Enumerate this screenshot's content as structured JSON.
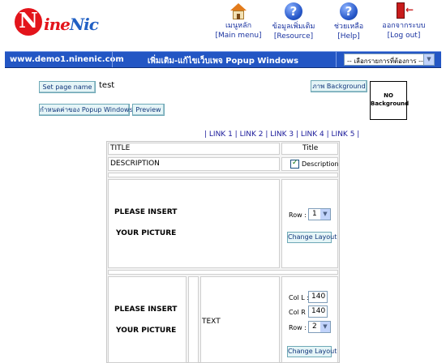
{
  "brand": {
    "logo_n": "N",
    "logo_rest_red": "ine",
    "logo_rest_blue": "Nic",
    "colors": {
      "red": "#e3141b",
      "blue": "#2160c4",
      "bar": "#2356c4"
    }
  },
  "nav": [
    {
      "icon": "home-icon",
      "thai": "เมนูหลัก",
      "eng": "[Main menu]"
    },
    {
      "icon": "resource-help-icon",
      "thai": "ข้อมูลเพิ่มเติม",
      "eng": "[Resource]"
    },
    {
      "icon": "help-icon",
      "thai": "ช่วยเหลือ",
      "eng": "[Help]"
    },
    {
      "icon": "logout-door-icon",
      "thai": "ออกจากระบบ",
      "eng": "[Log out]"
    }
  ],
  "bar": {
    "site": "www.demo1.ninenic.com",
    "title": "เพิ่มเติม-แก้ไขเว็บเพจ Popup Windows",
    "menu_select": "-- เลือกรายการที่ต้องการ --"
  },
  "controls": {
    "set_page_name": "Set page name",
    "page_name_value": "test",
    "set_popup": "กำหนดค่าของ Popup Windows",
    "preview": "Preview",
    "bg_button": "ภาพ Background",
    "no_bg_line1": "NO",
    "no_bg_line2": "Background"
  },
  "links": [
    "LINK 1",
    "LINK 2",
    "LINK 3",
    "LINK 4",
    "LINK 5"
  ],
  "layout": {
    "title_label": "TITLE",
    "title_value": "Title",
    "desc_label": "DESCRIPTION",
    "desc_checkbox": "Description",
    "desc_checked": true,
    "picture_line1": "PLEASE INSERT",
    "picture_line2": "YOUR PICTURE",
    "text_label": "TEXT",
    "row_label": "Row :",
    "row1_value": "1",
    "row2_value": "2",
    "col_l_label": "Col L :",
    "col_l_value": "140",
    "col_r_label": "Col R :",
    "col_r_value": "140",
    "change_layout": "Change Layout"
  }
}
